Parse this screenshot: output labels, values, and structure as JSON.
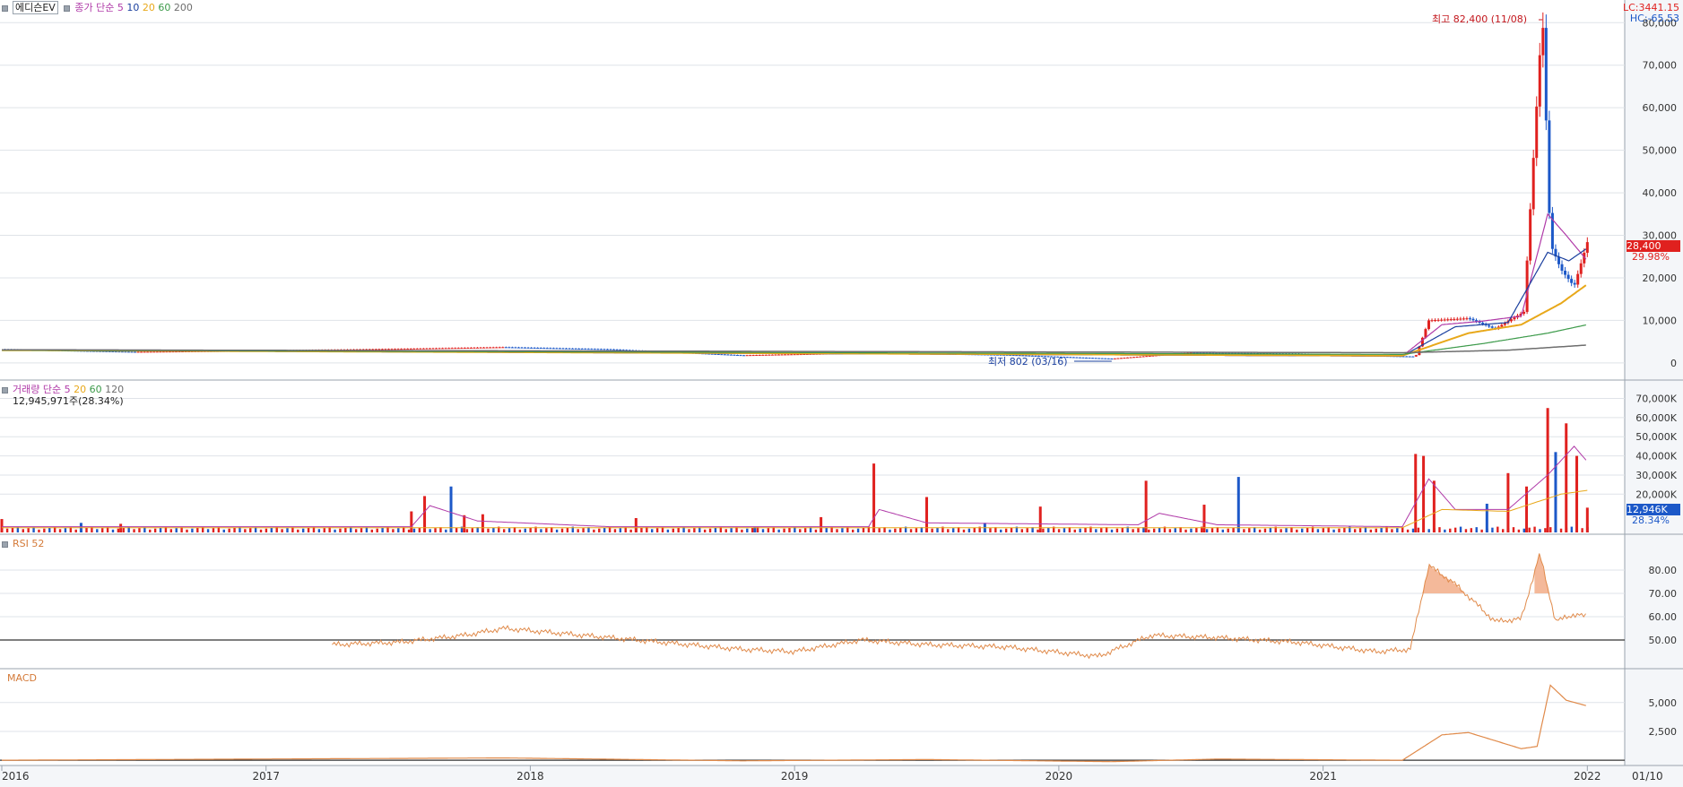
{
  "stock_name": "에디슨EV",
  "price_legend": {
    "label": "종가 단순",
    "periods": [
      "5",
      "10",
      "20",
      "60",
      "200"
    ]
  },
  "volume_legend": {
    "label": "거래량 단순",
    "periods": [
      "5",
      "20",
      "60",
      "120"
    ]
  },
  "volume_info": "12,945,971주(28.34%)",
  "rsi_label": "RSI 52",
  "macd_label": "MACD",
  "lc_label": "LC:3441.15",
  "hc_label": "HC:-65.53",
  "high_annotation": "최고 82,400 (11/08)",
  "low_annotation": "최저 802 (03/16)",
  "last_price_tag": "28,400",
  "last_change_tag": "29.98%",
  "last_volume_tag": "12,946K",
  "last_volume_pct_tag": "28.34%",
  "x_axis": {
    "labels": [
      "2016",
      "2017",
      "2018",
      "2019",
      "2020",
      "2021",
      "2022"
    ],
    "right_label": "01/10"
  },
  "colors": {
    "up": "#e0211f",
    "down": "#1c58c8",
    "ma5": "#b03aa8",
    "ma10": "#1a3f9e",
    "ma20": "#e8a81a",
    "ma60": "#3c9a4a",
    "ma200": "#6e6e6e",
    "rsi": "#e08a4a",
    "macd": "#e08a4a",
    "background": "#ffffff",
    "axis_bg": "#f4f6f9"
  },
  "chart_data": [
    {
      "type": "candlestick",
      "title": "에디슨EV",
      "y_ticks": [
        "0",
        "10,000",
        "20,000",
        "30,000",
        "40,000",
        "50,000",
        "60,000",
        "70,000",
        "80,000"
      ],
      "ylim": [
        -1500,
        82800
      ],
      "x_ticks": [
        "2016",
        "2017",
        "2018",
        "2019",
        "2020",
        "2021",
        "2022"
      ],
      "series": [
        {
          "name": "종가",
          "points": [
            [
              2016.0,
              3200
            ],
            [
              2016.5,
              2600
            ],
            [
              2017.0,
              2900
            ],
            [
              2017.5,
              3300
            ],
            [
              2017.9,
              3700
            ],
            [
              2018.3,
              3200
            ],
            [
              2018.8,
              1800
            ],
            [
              2019.3,
              2400
            ],
            [
              2019.8,
              1900
            ],
            [
              2020.2,
              1000
            ],
            [
              2020.5,
              2400
            ],
            [
              2020.9,
              2200
            ],
            [
              2021.1,
              1800
            ],
            [
              2021.35,
              1500
            ],
            [
              2021.4,
              10000
            ],
            [
              2021.55,
              10500
            ],
            [
              2021.65,
              8000
            ],
            [
              2021.76,
              12000
            ],
            [
              2021.83,
              82400
            ],
            [
              2021.86,
              28000
            ],
            [
              2021.9,
              22000
            ],
            [
              2021.95,
              18000
            ],
            [
              2022.0,
              28400
            ]
          ]
        },
        {
          "name": "5",
          "points": [
            [
              2016.0,
              3000
            ],
            [
              2021.3,
              1600
            ],
            [
              2021.45,
              9000
            ],
            [
              2021.6,
              9800
            ],
            [
              2021.75,
              11000
            ],
            [
              2021.85,
              35000
            ],
            [
              2021.92,
              30000
            ],
            [
              2022.0,
              24000
            ]
          ]
        },
        {
          "name": "10",
          "points": [
            [
              2016.0,
              3000
            ],
            [
              2021.3,
              1600
            ],
            [
              2021.5,
              8500
            ],
            [
              2021.7,
              9500
            ],
            [
              2021.85,
              26000
            ],
            [
              2021.93,
              24000
            ],
            [
              2022.0,
              27000
            ]
          ]
        },
        {
          "name": "20",
          "points": [
            [
              2016.0,
              3000
            ],
            [
              2021.3,
              1700
            ],
            [
              2021.55,
              7000
            ],
            [
              2021.75,
              9000
            ],
            [
              2021.9,
              14000
            ],
            [
              2022.0,
              18500
            ]
          ]
        },
        {
          "name": "60",
          "points": [
            [
              2016.0,
              3000
            ],
            [
              2021.3,
              2000
            ],
            [
              2021.6,
              4500
            ],
            [
              2021.85,
              7000
            ],
            [
              2022.0,
              9000
            ]
          ]
        },
        {
          "name": "200",
          "points": [
            [
              2016.0,
              3100
            ],
            [
              2021.3,
              2400
            ],
            [
              2021.7,
              3000
            ],
            [
              2022.0,
              4200
            ]
          ]
        }
      ],
      "annotations": [
        {
          "text": "최고 82,400 (11/08)",
          "x": 2021.83,
          "y": 82400
        },
        {
          "text": "최저 802 (03/16)",
          "x": 2020.2,
          "y": 802
        }
      ]
    },
    {
      "type": "bar",
      "title": "거래량",
      "y_ticks": [
        "20,000K",
        "30,000K",
        "40,000K",
        "50,000K",
        "60,000K",
        "70,000K"
      ],
      "ylim": [
        0,
        74000
      ],
      "units": "K shares",
      "spikes": [
        [
          2016.0,
          7000
        ],
        [
          2016.3,
          5000
        ],
        [
          2016.45,
          4500
        ],
        [
          2017.55,
          11000
        ],
        [
          2017.6,
          19000
        ],
        [
          2017.7,
          24000
        ],
        [
          2017.75,
          9000
        ],
        [
          2017.82,
          9500
        ],
        [
          2018.4,
          7500
        ],
        [
          2018.85,
          3000
        ],
        [
          2019.1,
          8000
        ],
        [
          2019.3,
          36000
        ],
        [
          2019.5,
          18500
        ],
        [
          2019.72,
          5000
        ],
        [
          2019.93,
          13500
        ],
        [
          2020.33,
          27000
        ],
        [
          2020.55,
          14500
        ],
        [
          2020.68,
          29000
        ],
        [
          2021.35,
          41000
        ],
        [
          2021.38,
          40000
        ],
        [
          2021.42,
          27000
        ],
        [
          2021.62,
          15000
        ],
        [
          2021.7,
          31000
        ],
        [
          2021.77,
          24000
        ],
        [
          2021.85,
          65000
        ],
        [
          2021.88,
          42000
        ],
        [
          2021.92,
          57000
        ],
        [
          2021.96,
          40000
        ],
        [
          2022.0,
          12946
        ]
      ]
    },
    {
      "type": "line",
      "title": "RSI 52",
      "y_ticks": [
        "50.00",
        "60.00",
        "70.00",
        "80.00"
      ],
      "ylim": [
        40,
        90
      ],
      "reference_line": 50,
      "points": [
        [
          2017.25,
          48
        ],
        [
          2017.5,
          49
        ],
        [
          2017.75,
          52
        ],
        [
          2017.9,
          55
        ],
        [
          2018.2,
          52
        ],
        [
          2018.5,
          49
        ],
        [
          2018.8,
          46
        ],
        [
          2019.0,
          45
        ],
        [
          2019.25,
          50
        ],
        [
          2019.5,
          48
        ],
        [
          2019.8,
          47
        ],
        [
          2020.15,
          43
        ],
        [
          2020.35,
          52
        ],
        [
          2020.6,
          51
        ],
        [
          2020.9,
          49
        ],
        [
          2021.2,
          45
        ],
        [
          2021.33,
          46
        ],
        [
          2021.4,
          82
        ],
        [
          2021.5,
          74
        ],
        [
          2021.65,
          58
        ],
        [
          2021.75,
          59
        ],
        [
          2021.82,
          87
        ],
        [
          2021.88,
          58
        ],
        [
          2021.95,
          61
        ],
        [
          2022.0,
          60
        ]
      ]
    },
    {
      "type": "line",
      "title": "MACD",
      "y_ticks": [
        "2,500",
        "5,000"
      ],
      "ylim": [
        -300,
        7000
      ],
      "points": [
        [
          2016.0,
          0
        ],
        [
          2017.9,
          200
        ],
        [
          2018.8,
          -50
        ],
        [
          2019.5,
          60
        ],
        [
          2020.2,
          -120
        ],
        [
          2020.6,
          100
        ],
        [
          2021.3,
          0
        ],
        [
          2021.45,
          2200
        ],
        [
          2021.55,
          2400
        ],
        [
          2021.75,
          1000
        ],
        [
          2021.81,
          1200
        ],
        [
          2021.86,
          6500
        ],
        [
          2021.92,
          5200
        ],
        [
          2022.0,
          4700
        ]
      ]
    }
  ]
}
